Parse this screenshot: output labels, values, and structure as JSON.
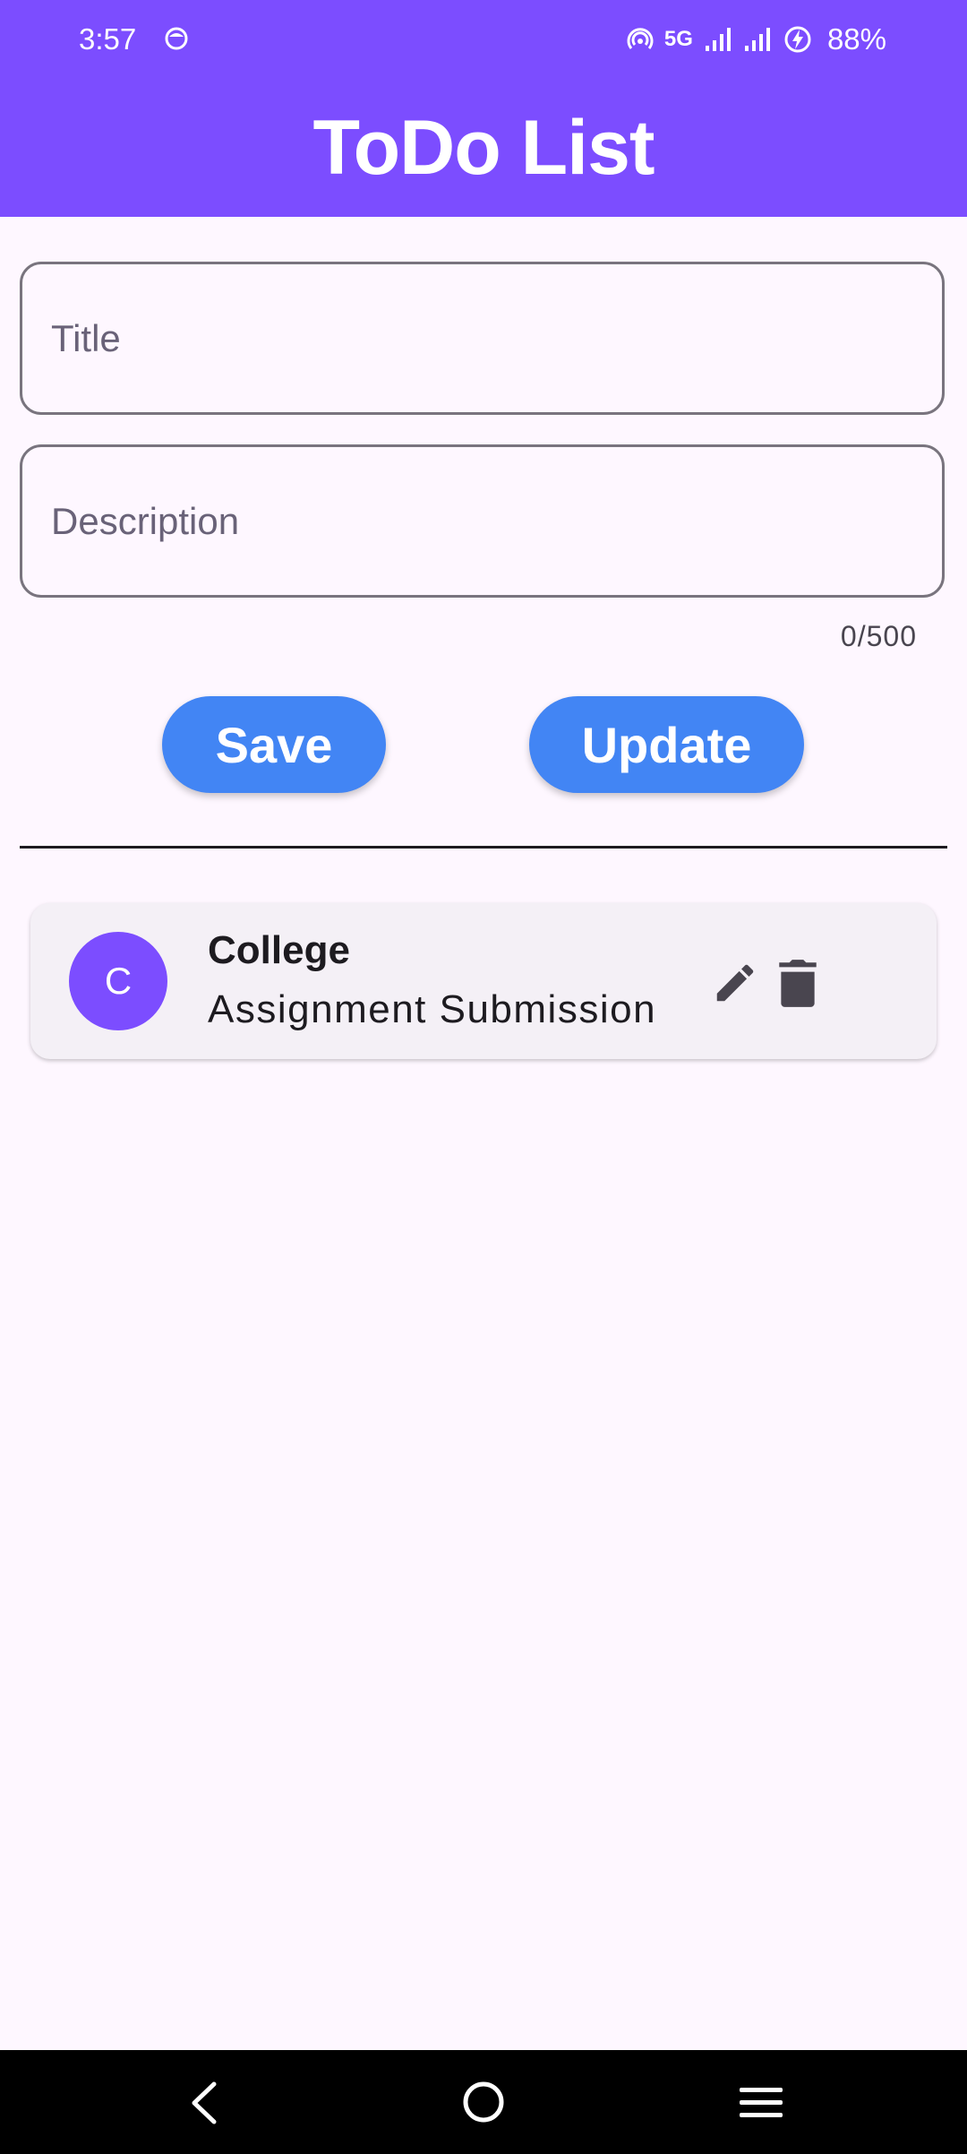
{
  "status_bar": {
    "time": "3:57",
    "network": "5G",
    "battery": "88%",
    "app_icon": "smiley-notification-icon",
    "icons": [
      "hotspot-icon",
      "signal-icon",
      "signal-icon",
      "battery-charging-icon"
    ]
  },
  "app_bar": {
    "title": "ToDo List",
    "color": "#7c4dff"
  },
  "form": {
    "title_placeholder": "Title",
    "title_value": "",
    "description_placeholder": "Description",
    "description_value": "",
    "description_counter": "0/500"
  },
  "buttons": {
    "save_label": "Save",
    "update_label": "Update",
    "color": "#4285f4"
  },
  "todos": [
    {
      "avatar_letter": "C",
      "title": "College",
      "subtitle": "Assignment Submission",
      "actions": [
        "edit-icon",
        "delete-icon"
      ]
    }
  ],
  "nav_bar": {
    "icons": [
      "back-icon",
      "home-icon",
      "recents-icon"
    ]
  }
}
